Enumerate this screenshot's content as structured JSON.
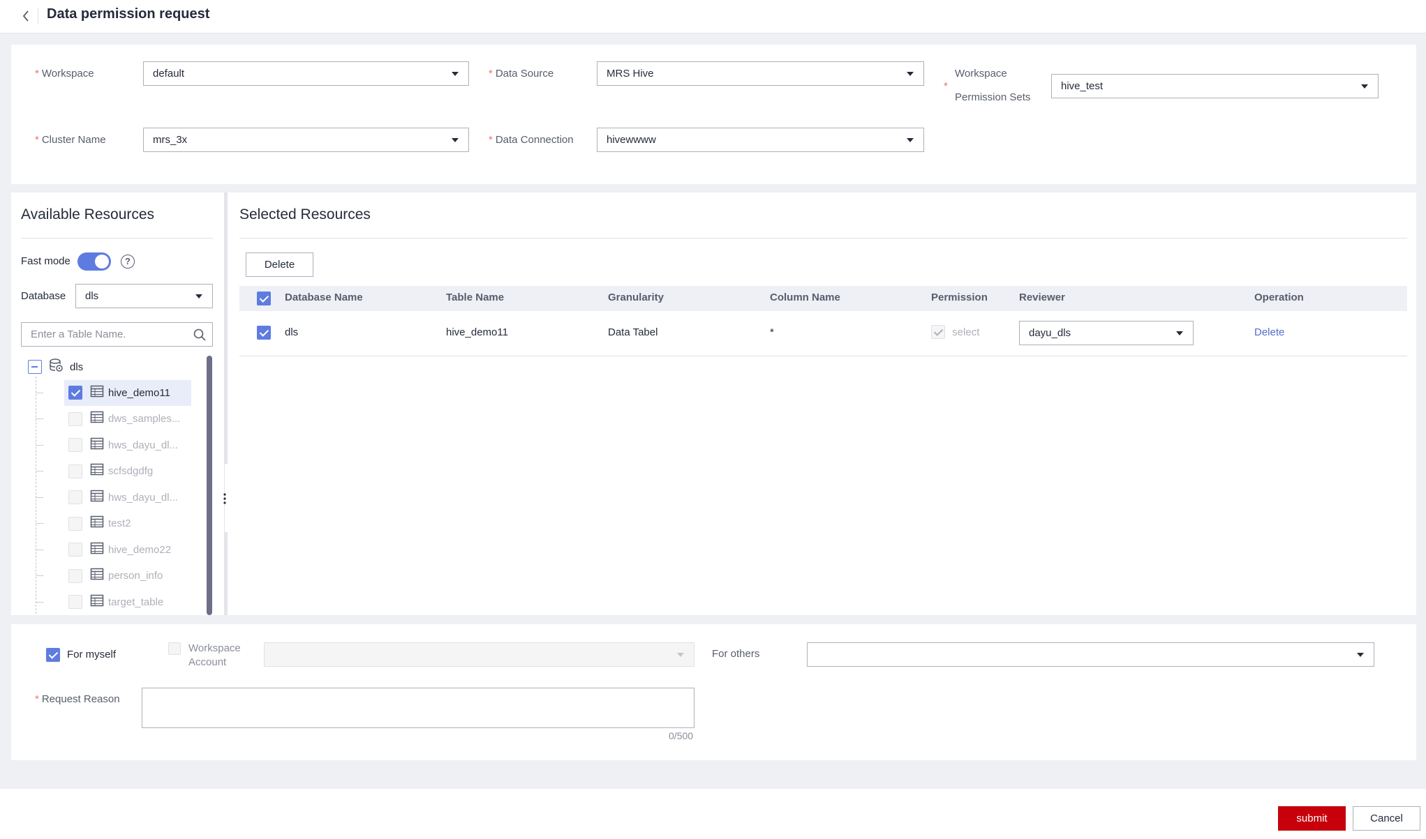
{
  "header": {
    "title": "Data permission request",
    "back_icon": "chevron-left-icon"
  },
  "form": {
    "workspace": {
      "label": "Workspace",
      "value": "default"
    },
    "data_source": {
      "label": "Data Source",
      "value": "MRS Hive"
    },
    "permission_sets": {
      "label_line1": "Workspace",
      "label_line2": "Permission Sets",
      "value": "hive_test"
    },
    "cluster_name": {
      "label": "Cluster Name",
      "value": "mrs_3x"
    },
    "data_connection": {
      "label": "Data Connection",
      "value": "hivewwww"
    }
  },
  "available": {
    "title": "Available Resources",
    "fast_mode_label": "Fast mode",
    "fast_mode_on": true,
    "help_glyph": "?",
    "database_label": "Database",
    "database_value": "dls",
    "search_placeholder": "Enter a Table Name.",
    "tree_root": "dls",
    "tables": [
      {
        "name": "hive_demo11",
        "checked": true
      },
      {
        "name": "dws_samples...",
        "checked": false
      },
      {
        "name": "hws_dayu_dl...",
        "checked": false
      },
      {
        "name": "scfsdgdfg",
        "checked": false
      },
      {
        "name": "hws_dayu_dl...",
        "checked": false
      },
      {
        "name": "test2",
        "checked": false
      },
      {
        "name": "hive_demo22",
        "checked": false
      },
      {
        "name": "person_info",
        "checked": false
      },
      {
        "name": "target_table",
        "checked": false
      }
    ]
  },
  "selected": {
    "title": "Selected Resources",
    "delete_button": "Delete",
    "columns": [
      "Database Name",
      "Table Name",
      "Granularity",
      "Column Name",
      "Permission",
      "Reviewer",
      "Operation"
    ],
    "rows": [
      {
        "database": "dls",
        "table": "hive_demo11",
        "granularity": "Data Tabel",
        "column": "*",
        "permission": "select",
        "reviewer": "dayu_dls",
        "operation": "Delete"
      }
    ]
  },
  "request": {
    "for_myself_label": "For myself",
    "for_myself_checked": true,
    "workspace_account_line1": "Workspace",
    "workspace_account_line2": "Account",
    "workspace_account_value": "",
    "for_others_label": "For others",
    "for_others_value": "",
    "reason_label": "Request Reason",
    "reason_value": "",
    "reason_counter": "0/500"
  },
  "footer": {
    "submit": "submit",
    "cancel": "Cancel"
  },
  "colors": {
    "accent": "#5e7ce0",
    "primary_button": "#c7000b",
    "required": "#f66f6a",
    "link": "#526ecc"
  }
}
